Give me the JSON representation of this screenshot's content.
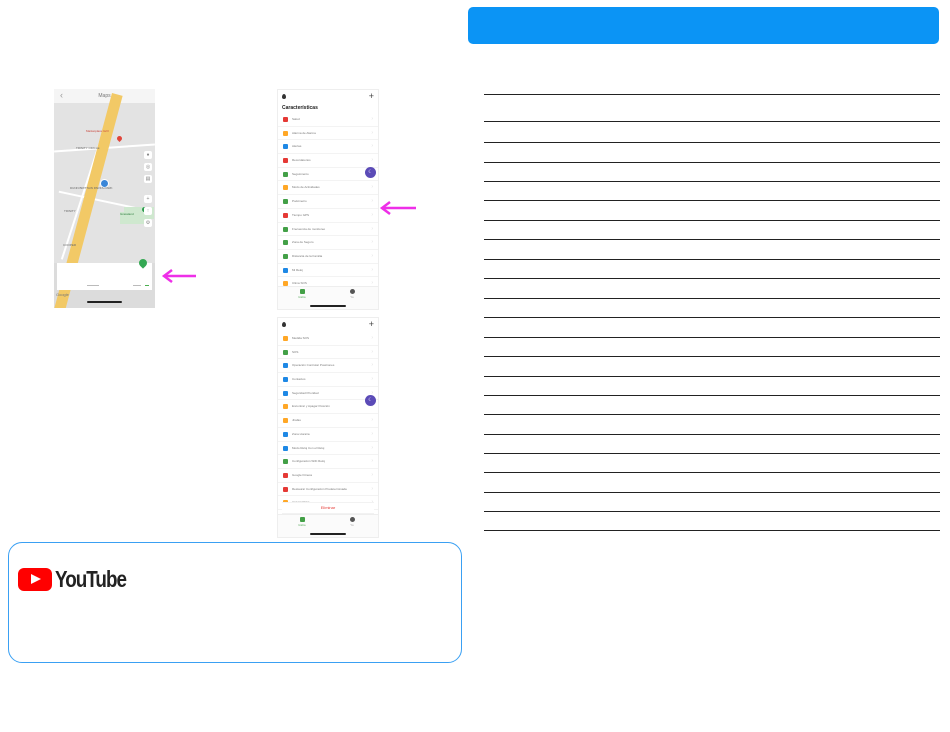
{
  "map_screen": {
    "title": "Maps",
    "back_icon": "chevron-left-icon",
    "labels": {
      "place_red": "Marketplace Grill",
      "trinity_circle": "TRINITY CIRCLE",
      "dunn": "DUNN BRITTAIN PARKS PARK",
      "trinity": "TRINITY",
      "cooper": "COOPER",
      "green_place": "Grassland"
    },
    "google_text": "Google"
  },
  "features_screen_1": {
    "section_title": "Características",
    "items": [
      {
        "label": "Salud",
        "icon": "heart-icon",
        "color": "#e53935"
      },
      {
        "label": "Alarma de Alarma",
        "icon": "alarm-icon",
        "color": "#ffa726"
      },
      {
        "label": "Alertas",
        "icon": "shield-icon",
        "color": "#1e88e5"
      },
      {
        "label": "Recordatorios",
        "icon": "bell-icon",
        "color": "#e53935"
      },
      {
        "label": "Seguimiento",
        "icon": "camera-icon",
        "color": "#43a047"
      },
      {
        "label": "Modo de Actividades",
        "icon": "activity-icon",
        "color": "#ffa726"
      },
      {
        "label": "Podómetro",
        "icon": "steps-icon",
        "color": "#43a047"
      },
      {
        "label": "Tiempo GPS",
        "icon": "gps-icon",
        "color": "#e53935"
      },
      {
        "label": "Frecuencia de monitoreo",
        "icon": "monitor-icon",
        "color": "#43a047"
      },
      {
        "label": "Zona de Seguro",
        "icon": "shield-check-icon",
        "color": "#43a047"
      },
      {
        "label": "Distancia de la Familia",
        "icon": "family-icon",
        "color": "#43a047"
      },
      {
        "label": "Mi Reloj",
        "icon": "globe-icon",
        "color": "#1e88e5"
      },
      {
        "label": "Clima SOS",
        "icon": "sun-icon",
        "color": "#ffa726"
      },
      {
        "label": "SOS",
        "icon": "sos-icon",
        "color": "#43a047"
      }
    ],
    "tabs": [
      {
        "label": "Inicio",
        "icon": "home-icon",
        "color": "#43a047"
      },
      {
        "label": "Yo",
        "icon": "person-icon",
        "color": "#555555"
      }
    ],
    "fab_icon": "moon-icon"
  },
  "features_screen_2": {
    "items": [
      {
        "label": "Medida SOS",
        "icon": "sun-icon",
        "color": "#ffa726"
      },
      {
        "label": "SOS",
        "icon": "sos-icon",
        "color": "#43a047"
      },
      {
        "label": "Operación Controlar Posiciones",
        "icon": "globe-icon",
        "color": "#1e88e5"
      },
      {
        "label": "Contactos",
        "icon": "contacts-icon",
        "color": "#1e88e5"
      },
      {
        "label": "Seguridad Prioridad",
        "icon": "lock-icon",
        "color": "#1e88e5"
      },
      {
        "label": "Encontrar y Apagar Posición",
        "icon": "locate-icon",
        "color": "#ffa726"
      },
      {
        "label": "Jirafas",
        "icon": "heart-icon",
        "color": "#ffa726"
      },
      {
        "label": "Zona Horaria",
        "icon": "clock-icon",
        "color": "#1e88e5"
      },
      {
        "label": "Modo Reloj Con el Reloj",
        "icon": "watch-icon",
        "color": "#1e88e5"
      },
      {
        "label": "Configuración WiFi Reloj",
        "icon": "wifi-icon",
        "color": "#43a047"
      },
      {
        "label": "Google Fitness",
        "icon": "google-icon",
        "color": "#e53935"
      },
      {
        "label": "Restaurar Configuración Predeterminada",
        "icon": "reset-icon",
        "color": "#e53935"
      },
      {
        "label": "Apagar Reloj",
        "icon": "power-icon",
        "color": "#ffa726"
      }
    ],
    "delete_label": "Eliminar",
    "tabs": [
      {
        "label": "Inicio",
        "icon": "home-icon",
        "color": "#43a047"
      },
      {
        "label": "Yo",
        "icon": "person-icon",
        "color": "#555555"
      }
    ],
    "fab_icon": "moon-icon"
  },
  "annotation": {
    "arrow_color": "#ee2fe8"
  },
  "youtube": {
    "wordmark": "YouTube",
    "icon": "youtube-play-icon",
    "border_color": "#3aa0f3"
  },
  "right_panel": {
    "header_color": "#0b94f5",
    "rule_count": 23
  }
}
